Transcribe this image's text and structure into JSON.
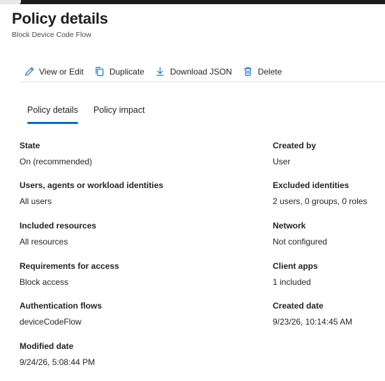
{
  "header": {
    "title": "Policy details",
    "subtitle": "Block Device Code Flow"
  },
  "toolbar": {
    "view_edit": "View or Edit",
    "duplicate": "Duplicate",
    "download_json": "Download JSON",
    "delete": "Delete"
  },
  "tabs": {
    "details": "Policy details",
    "impact": "Policy impact",
    "active": "Policy details"
  },
  "fields": {
    "state": {
      "label": "State",
      "value": "On (recommended)"
    },
    "created_by": {
      "label": "Created by",
      "value": "User"
    },
    "users": {
      "label": "Users, agents or workload identities",
      "value": "All users"
    },
    "excluded": {
      "label": "Excluded identities",
      "value": "2 users, 0 groups, 0 roles"
    },
    "included_resources": {
      "label": "Included resources",
      "value": "All resources"
    },
    "network": {
      "label": "Network",
      "value": "Not configured"
    },
    "requirements": {
      "label": "Requirements for access",
      "value": "Block access"
    },
    "client_apps": {
      "label": "Client apps",
      "value": "1 included"
    },
    "auth_flows": {
      "label": "Authentication flows",
      "value": "deviceCodeFlow"
    },
    "created_date": {
      "label": "Created date",
      "value": "9/23/26, 10:14:45 AM"
    },
    "modified_date": {
      "label": "Modified date",
      "value": "9/24/26, 5:08:44 PM"
    }
  },
  "icons": {
    "view_edit": "pencil-icon",
    "duplicate": "copy-icon",
    "download": "download-icon",
    "delete": "trash-icon"
  },
  "colors": {
    "accent": "#0f6cbd",
    "text": "#242424"
  }
}
